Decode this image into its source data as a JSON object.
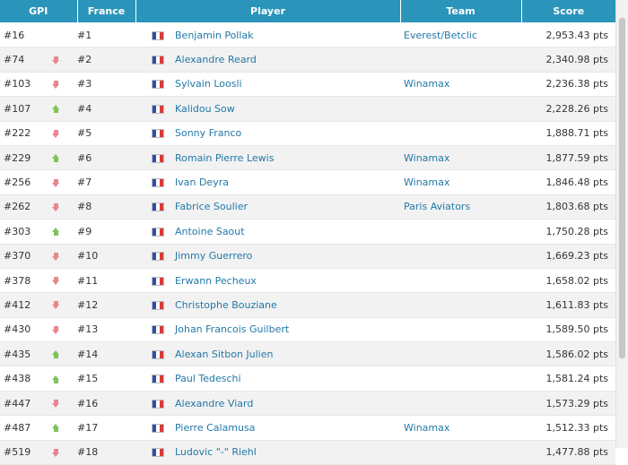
{
  "headers": {
    "gpi": "GPI",
    "france": "France",
    "player": "Player",
    "team": "Team",
    "score": "Score"
  },
  "rows": [
    {
      "gpi": "#16",
      "trend": "none",
      "fr": "#1",
      "player": "Benjamin Pollak",
      "team": "Everest/Betclic",
      "score": "2,953.43 pts"
    },
    {
      "gpi": "#74",
      "trend": "down",
      "fr": "#2",
      "player": "Alexandre Reard",
      "team": "",
      "score": "2,340.98 pts"
    },
    {
      "gpi": "#103",
      "trend": "down",
      "fr": "#3",
      "player": "Sylvain Loosli",
      "team": "Winamax",
      "score": "2,236.38 pts"
    },
    {
      "gpi": "#107",
      "trend": "up",
      "fr": "#4",
      "player": "Kalidou Sow",
      "team": "",
      "score": "2,228.26 pts"
    },
    {
      "gpi": "#222",
      "trend": "down",
      "fr": "#5",
      "player": "Sonny Franco",
      "team": "",
      "score": "1,888.71 pts"
    },
    {
      "gpi": "#229",
      "trend": "up",
      "fr": "#6",
      "player": "Romain Pierre Lewis",
      "team": "Winamax",
      "score": "1,877.59 pts"
    },
    {
      "gpi": "#256",
      "trend": "down",
      "fr": "#7",
      "player": "Ivan Deyra",
      "team": "Winamax",
      "score": "1,846.48 pts"
    },
    {
      "gpi": "#262",
      "trend": "down",
      "fr": "#8",
      "player": "Fabrice Soulier",
      "team": "Paris Aviators",
      "score": "1,803.68 pts"
    },
    {
      "gpi": "#303",
      "trend": "up",
      "fr": "#9",
      "player": "Antoine Saout",
      "team": "",
      "score": "1,750.28 pts"
    },
    {
      "gpi": "#370",
      "trend": "down",
      "fr": "#10",
      "player": "Jimmy Guerrero",
      "team": "",
      "score": "1,669.23 pts"
    },
    {
      "gpi": "#378",
      "trend": "down",
      "fr": "#11",
      "player": "Erwann Pecheux",
      "team": "",
      "score": "1,658.02 pts"
    },
    {
      "gpi": "#412",
      "trend": "down",
      "fr": "#12",
      "player": "Christophe Bouziane",
      "team": "",
      "score": "1,611.83 pts"
    },
    {
      "gpi": "#430",
      "trend": "down",
      "fr": "#13",
      "player": "Johan Francois Guilbert",
      "team": "",
      "score": "1,589.50 pts"
    },
    {
      "gpi": "#435",
      "trend": "up",
      "fr": "#14",
      "player": "Alexan Sitbon Julien",
      "team": "",
      "score": "1,586.02 pts"
    },
    {
      "gpi": "#438",
      "trend": "up",
      "fr": "#15",
      "player": "Paul Tedeschi",
      "team": "",
      "score": "1,581.24 pts"
    },
    {
      "gpi": "#447",
      "trend": "down",
      "fr": "#16",
      "player": "Alexandre Viard",
      "team": "",
      "score": "1,573.29 pts"
    },
    {
      "gpi": "#487",
      "trend": "up",
      "fr": "#17",
      "player": "Pierre Calamusa",
      "team": "Winamax",
      "score": "1,512.33 pts"
    },
    {
      "gpi": "#519",
      "trend": "down",
      "fr": "#18",
      "player": "Ludovic \"-\" Riehl",
      "team": "",
      "score": "1,477.88 pts"
    }
  ],
  "colors": {
    "header_bg": "#2b94ba",
    "link": "#2378a8",
    "arrow_up": "#7fc35b",
    "arrow_down": "#e8868f"
  }
}
